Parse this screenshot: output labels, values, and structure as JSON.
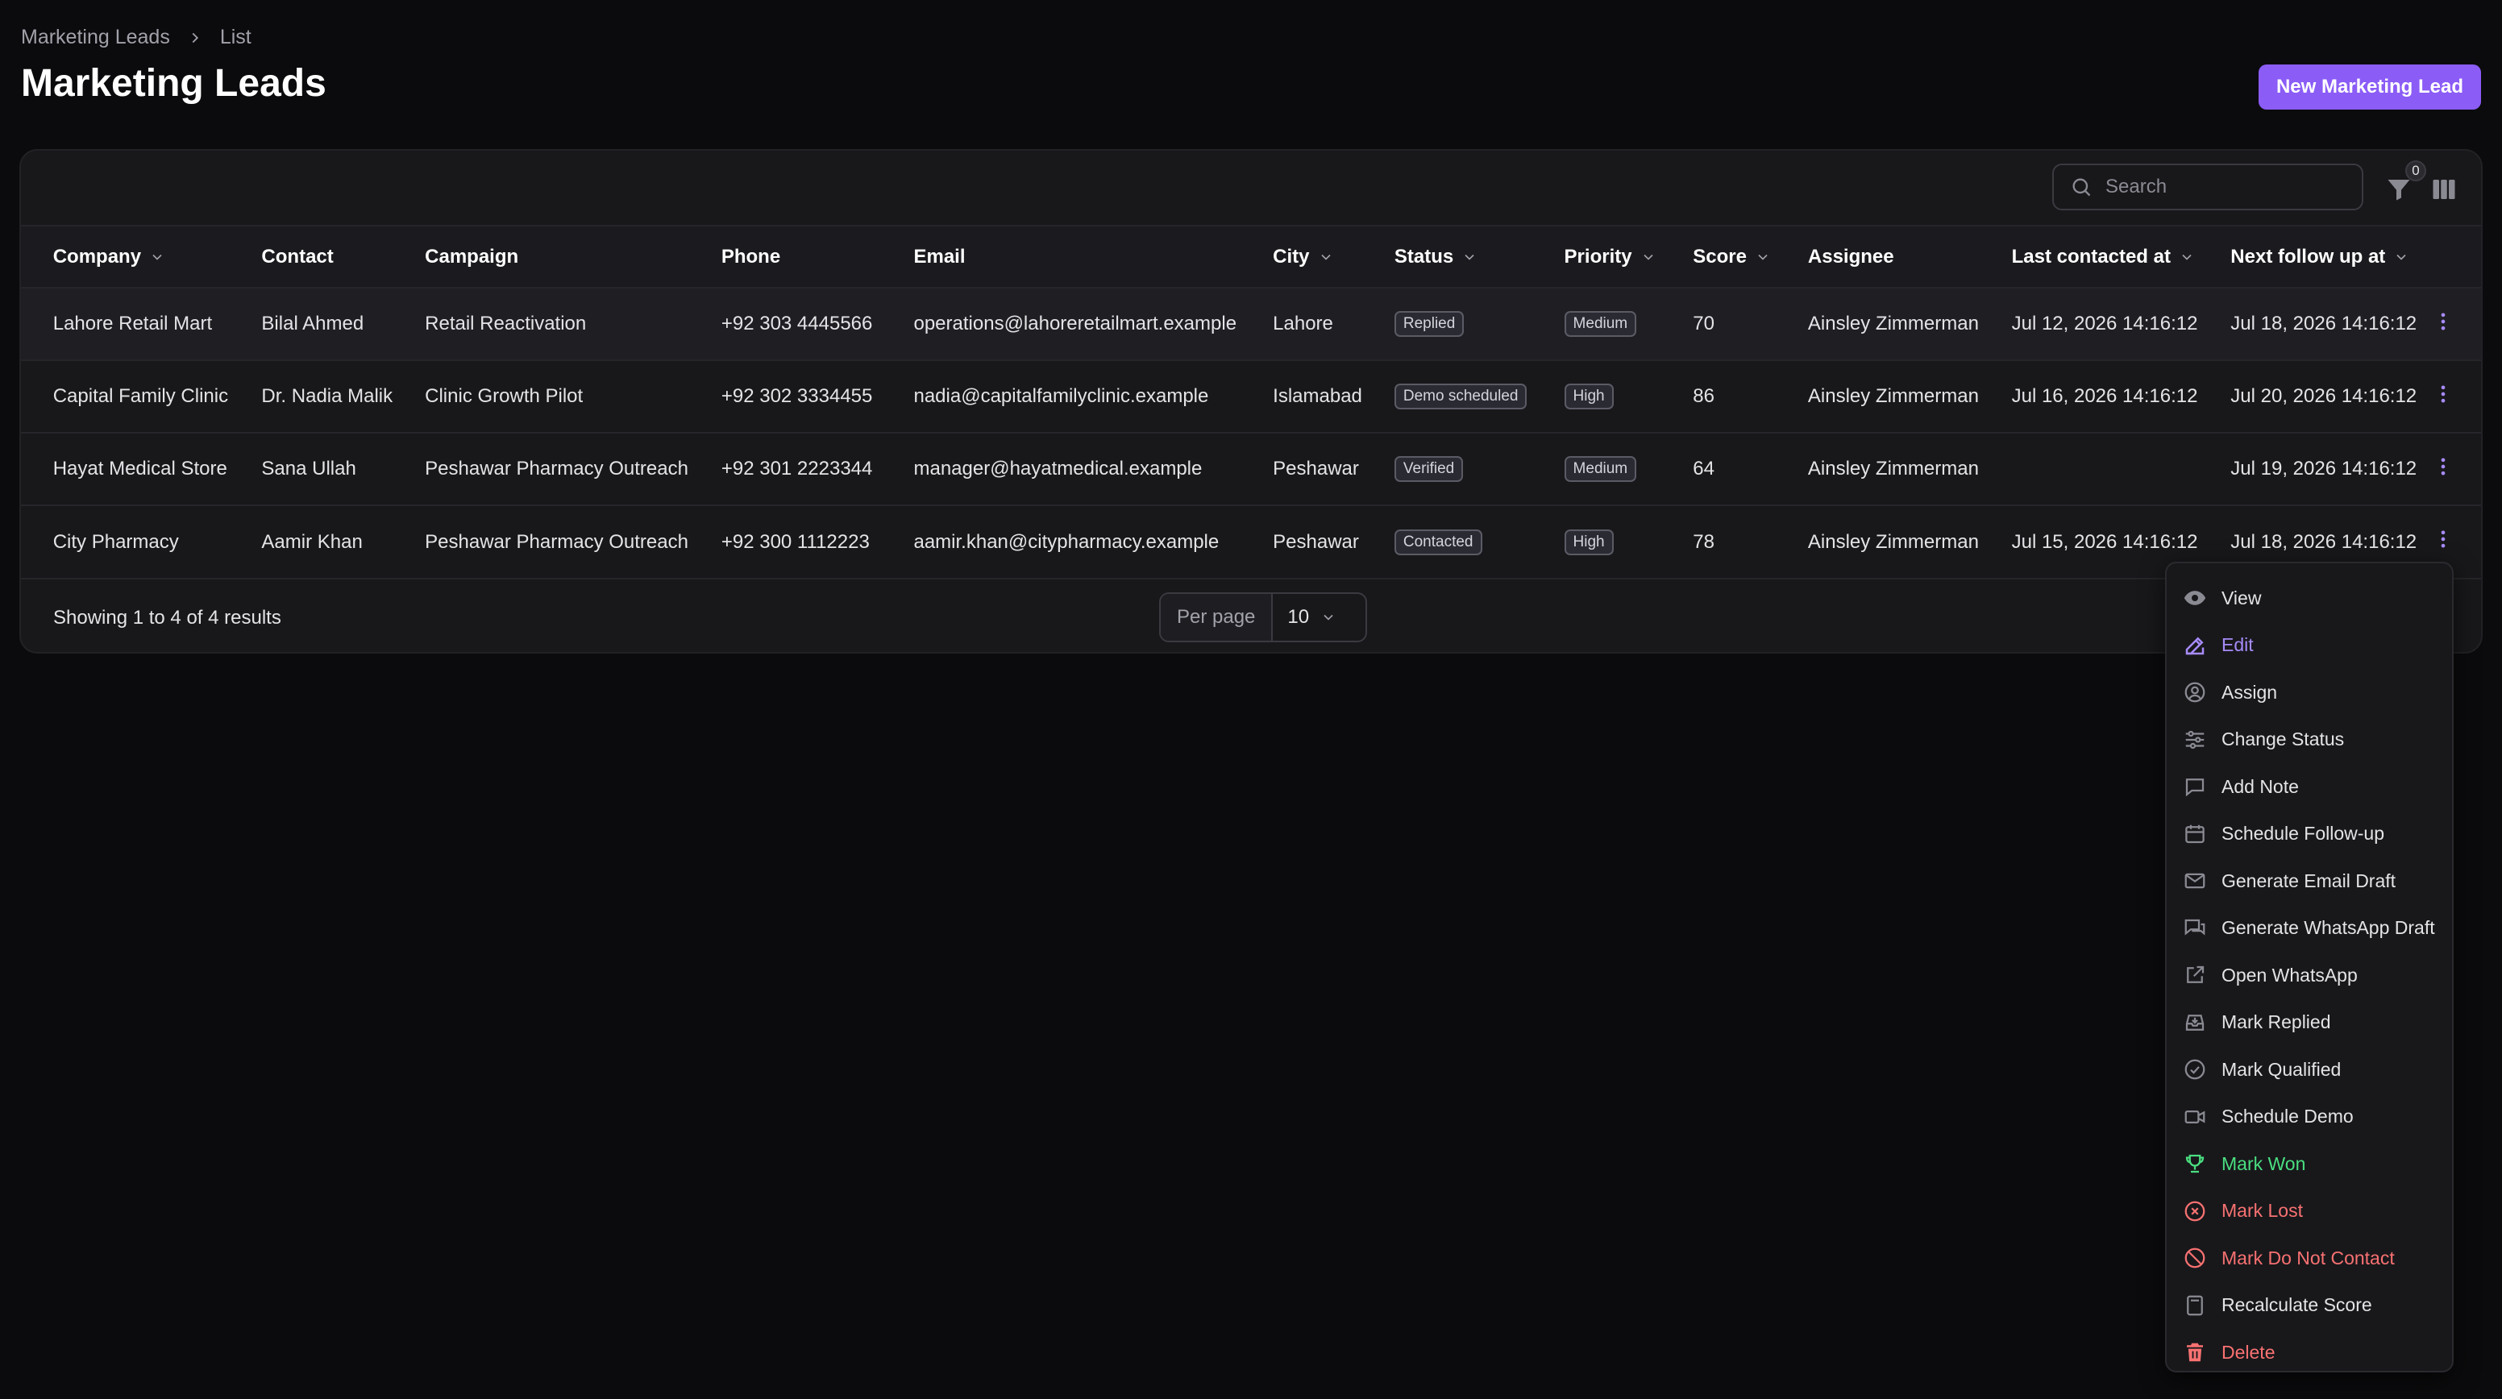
{
  "breadcrumb": {
    "root": "Marketing Leads",
    "current": "List"
  },
  "page_title": "Marketing Leads",
  "new_button": "New Marketing Lead",
  "search": {
    "placeholder": "Search"
  },
  "filter_count": "0",
  "columns": {
    "company": "Company",
    "contact": "Contact",
    "campaign": "Campaign",
    "phone": "Phone",
    "email": "Email",
    "city": "City",
    "status": "Status",
    "priority": "Priority",
    "score": "Score",
    "assignee": "Assignee",
    "last_contacted": "Last contacted at",
    "next_follow_up": "Next follow up at"
  },
  "rows": [
    {
      "company": "Lahore Retail Mart",
      "contact": "Bilal Ahmed",
      "campaign": "Retail Reactivation",
      "phone": "+92 303 4445566",
      "email": "operations@lahoreretailmart.example",
      "city": "Lahore",
      "status": "Replied",
      "priority": "Medium",
      "score": "70",
      "assignee": "Ainsley Zimmerman",
      "last_contacted": "Jul 12, 2026 14:16:12",
      "next_follow_up": "Jul 18, 2026 14:16:12"
    },
    {
      "company": "Capital Family Clinic",
      "contact": "Dr. Nadia Malik",
      "campaign": "Clinic Growth Pilot",
      "phone": "+92 302 3334455",
      "email": "nadia@capitalfamilyclinic.example",
      "city": "Islamabad",
      "status": "Demo scheduled",
      "priority": "High",
      "score": "86",
      "assignee": "Ainsley Zimmerman",
      "last_contacted": "Jul 16, 2026 14:16:12",
      "next_follow_up": "Jul 20, 2026 14:16:12"
    },
    {
      "company": "Hayat Medical Store",
      "contact": "Sana Ullah",
      "campaign": "Peshawar Pharmacy Outreach",
      "phone": "+92 301 2223344",
      "email": "manager@hayatmedical.example",
      "city": "Peshawar",
      "status": "Verified",
      "priority": "Medium",
      "score": "64",
      "assignee": "Ainsley Zimmerman",
      "last_contacted": "",
      "next_follow_up": "Jul 19, 2026 14:16:12"
    },
    {
      "company": "City Pharmacy",
      "contact": "Aamir Khan",
      "campaign": "Peshawar Pharmacy Outreach",
      "phone": "+92 300 1112223",
      "email": "aamir.khan@citypharmacy.example",
      "city": "Peshawar",
      "status": "Contacted",
      "priority": "High",
      "score": "78",
      "assignee": "Ainsley Zimmerman",
      "last_contacted": "Jul 15, 2026 14:16:12",
      "next_follow_up": "Jul 18, 2026 14:16:12"
    }
  ],
  "footer": {
    "results": "Showing 1 to 4 of 4 results",
    "per_page_label": "Per page",
    "per_page_value": "10"
  },
  "menu": {
    "items": [
      {
        "label": "View",
        "icon": "eye-icon"
      },
      {
        "label": "Edit",
        "icon": "pencil-square-icon"
      },
      {
        "label": "Assign",
        "icon": "user-circle-icon"
      },
      {
        "label": "Change Status",
        "icon": "sliders-icon"
      },
      {
        "label": "Add Note",
        "icon": "chat-bubble-icon"
      },
      {
        "label": "Schedule Follow-up",
        "icon": "calendar-icon"
      },
      {
        "label": "Generate Email Draft",
        "icon": "envelope-icon"
      },
      {
        "label": "Generate WhatsApp Draft",
        "icon": "chat-bubbles-icon"
      },
      {
        "label": "Open WhatsApp",
        "icon": "external-link-icon"
      },
      {
        "label": "Mark Replied",
        "icon": "inbox-icon"
      },
      {
        "label": "Mark Qualified",
        "icon": "check-circle-icon"
      },
      {
        "label": "Schedule Demo",
        "icon": "video-camera-icon"
      },
      {
        "label": "Mark Won",
        "icon": "trophy-icon"
      },
      {
        "label": "Mark Lost",
        "icon": "x-circle-icon"
      },
      {
        "label": "Mark Do Not Contact",
        "icon": "no-symbol-icon"
      },
      {
        "label": "Recalculate Score",
        "icon": "calculator-icon"
      },
      {
        "label": "Delete",
        "icon": "trash-icon"
      }
    ]
  },
  "colors": {
    "background": "#0b0b0d",
    "card": "#18181b",
    "accent": "#8b5cf6",
    "accent_text": "#a78bfa",
    "success": "#4ade80",
    "danger": "#f87171"
  }
}
